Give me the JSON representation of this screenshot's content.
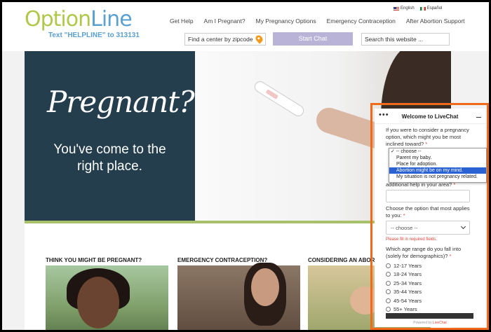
{
  "brand": {
    "logo_prefix": "Option",
    "logo_suffix": "Line",
    "tagline": "Text \"HELPLINE\" to 313131"
  },
  "languages": [
    {
      "label": "English"
    },
    {
      "label": "Español"
    }
  ],
  "nav": [
    "Get Help",
    "Am I Pregnant?",
    "My Pregnancy Options",
    "Emergency Contraception",
    "After Abortion Support"
  ],
  "zipcode": {
    "placeholder": "Find a center by zipcode"
  },
  "start_chat_label": "Start Chat",
  "search": {
    "placeholder": "Search this website ..."
  },
  "hero": {
    "title": "Pregnant?",
    "subtitle_line1": "You've come to the",
    "subtitle_line2": "right place."
  },
  "cards": [
    {
      "title": "THINK YOU MIGHT BE PREGNANT?"
    },
    {
      "title": "EMERGENCY CONTRACEPTION?"
    },
    {
      "title": "CONSIDERING AN ABORTIO"
    }
  ],
  "chat": {
    "title": "Welcome to LiveChat",
    "q1": "If you were to consider a pregnancy option, which might you be most inclined toward?",
    "dropdown_options": [
      {
        "label": "✓ -- choose --"
      },
      {
        "label": "Parent my baby."
      },
      {
        "label": "Place for adoption."
      },
      {
        "label": "Abortion might be on my mind."
      },
      {
        "label": "My situation is not pregnancy related."
      }
    ],
    "q2_tail": "additional help in your area?",
    "q3": "Choose the option that most applies to you:",
    "q3_select": "-- choose --",
    "error": "Please fill in required fields.",
    "q4": "Which age range do you fall into (solely for demographics)?",
    "required_mark": "*",
    "age_ranges": [
      "12-17 Years",
      "18-24 Years",
      "25-34 Years",
      "35-44 Years",
      "45-54 Years",
      "55+ Years"
    ],
    "powered_prefix": "Powered by",
    "powered_brand": "LiveChat"
  }
}
